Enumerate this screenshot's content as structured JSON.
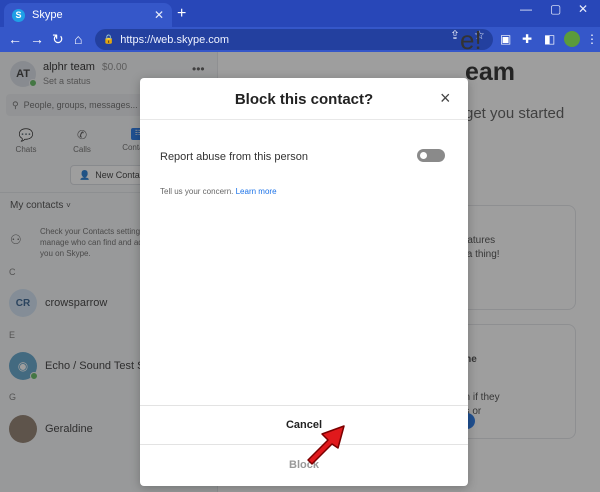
{
  "browser": {
    "tab_title": "Skype",
    "tab_favicon": "S",
    "url": "https://web.skype.com"
  },
  "sidebar": {
    "me": {
      "initials": "AT",
      "name": "alphr team",
      "credit": "$0.00",
      "status": "Set a status"
    },
    "search_placeholder": "People, groups, messages...",
    "nav": [
      {
        "label": "Chats",
        "icon": "chat-icon"
      },
      {
        "label": "Calls",
        "icon": "phone-icon"
      },
      {
        "label": "Contacts",
        "icon": "contacts-icon"
      }
    ],
    "new_contact_label": "New Contact",
    "my_contacts_label": "My contacts",
    "hint_text": "Check your Contacts settings to manage who can find and add you on Skype.",
    "sections": [
      {
        "letter": "C",
        "contact": {
          "initials": "CR",
          "name": "crowsparrow"
        }
      },
      {
        "letter": "E",
        "contact": {
          "initials": "",
          "name": "Echo / Sound Test Service"
        }
      },
      {
        "letter": "G",
        "contact": {
          "initials": "",
          "name": "Geraldine"
        }
      }
    ]
  },
  "welcome": {
    "line1": "e!",
    "line2": "eam",
    "line3": "get you started",
    "card1": "features\ns a thing!",
    "card2_title": "one",
    "card2_body": "en if they\nus or"
  },
  "modal": {
    "title": "Block this contact?",
    "close_label": "×",
    "report_label": "Report abuse from this person",
    "report_enabled": false,
    "concern_text": "Tell us your concern.",
    "learn_more": "Learn more",
    "cancel_label": "Cancel",
    "block_label": "Block"
  },
  "colors": {
    "browser_chrome": "#3557c9",
    "accent": "#1b72e8",
    "annotation_arrow": "#e0191c"
  }
}
